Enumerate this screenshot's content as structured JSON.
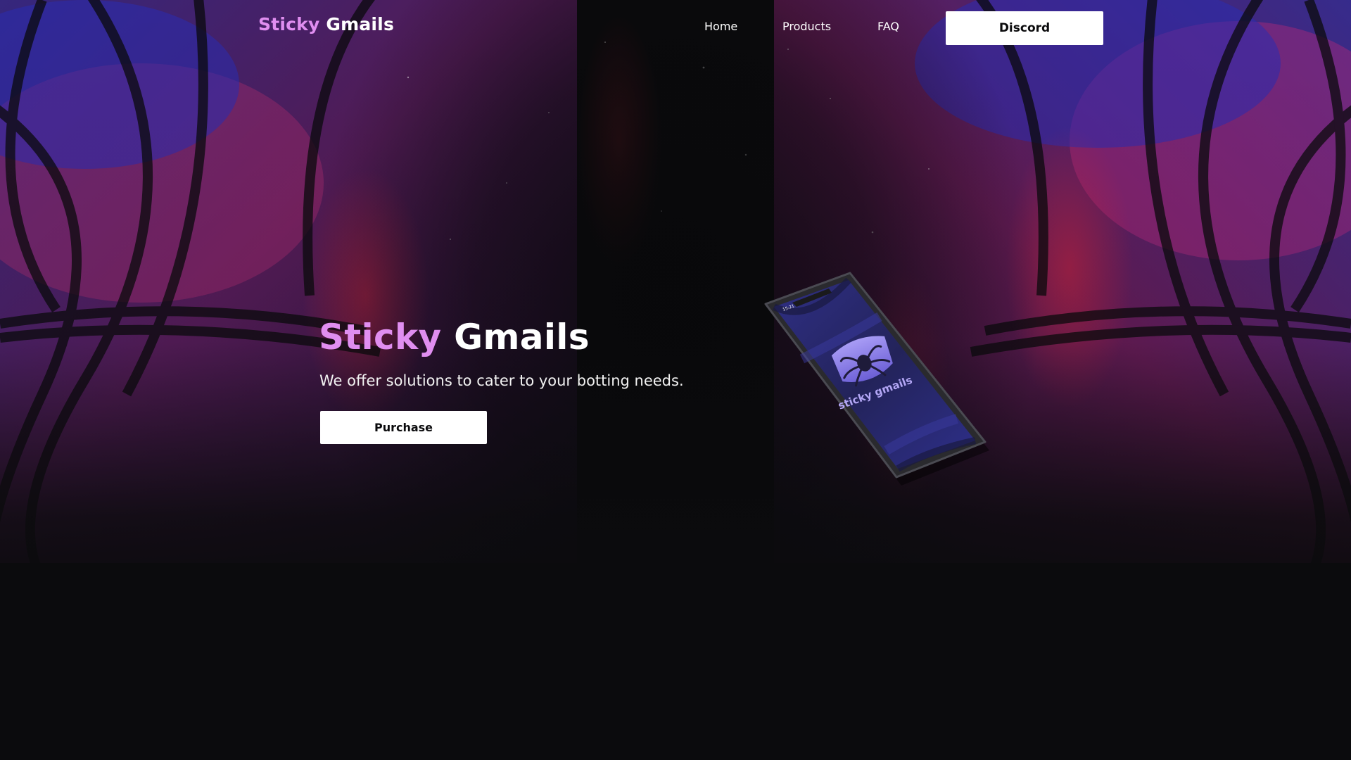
{
  "nav": {
    "brand_accent": "Sticky",
    "brand_rest": "Gmails",
    "links": [
      {
        "label": "Home"
      },
      {
        "label": "Products"
      },
      {
        "label": "FAQ"
      }
    ],
    "cta_label": "Discord"
  },
  "hero": {
    "title_accent": "Sticky",
    "title_rest": "Gmails",
    "subtitle": "We offer solutions to cater to your botting needs.",
    "button_label": "Purchase"
  },
  "phone": {
    "status_time": "15:21",
    "logo_text": "sticky gmails",
    "logo_icon": "spider-icon"
  },
  "colors": {
    "accent": "#e08ef0",
    "background": "#0b0b0d",
    "button_bg": "#ffffff",
    "phone_screen": "#2b2e7a",
    "logo_badge": "#8c7ee8"
  }
}
